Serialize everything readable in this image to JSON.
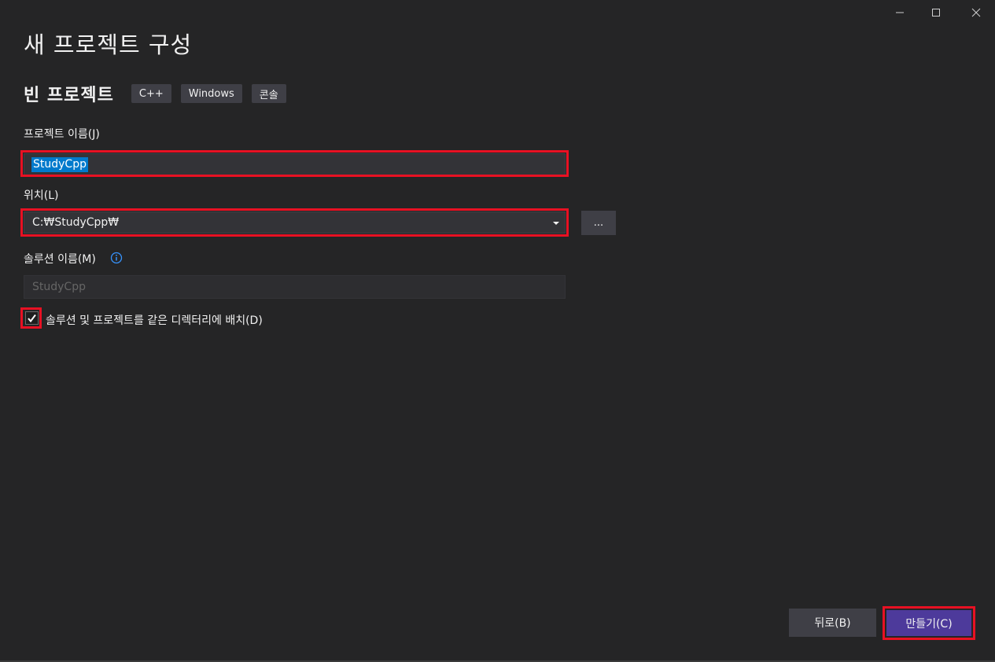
{
  "window": {
    "title": "새 프로젝트 구성",
    "controls": {
      "minimize_icon": "minimize-icon",
      "maximize_icon": "maximize-icon",
      "close_icon": "close-icon"
    }
  },
  "template": {
    "name": "빈 프로젝트",
    "tags": [
      "C++",
      "Windows",
      "콘솔"
    ]
  },
  "form": {
    "project_name": {
      "label": "프로젝트 이름(J)",
      "value": "StudyCpp"
    },
    "location": {
      "label": "위치(L)",
      "value": "C:₩StudyCpp₩",
      "browse_label": "..."
    },
    "solution_name": {
      "label": "솔루션 이름(M)",
      "placeholder": "StudyCpp",
      "info_icon": "info-icon"
    },
    "same_directory": {
      "label": "솔루션 및 프로젝트를 같은 디렉터리에 배치(D)",
      "checked": true
    }
  },
  "footer": {
    "back_label": "뒤로(B)",
    "create_label": "만들기(C)"
  },
  "colors": {
    "background": "#252526",
    "highlight": "#e81123",
    "accent": "#4d3a9b",
    "selection": "#007acc"
  }
}
